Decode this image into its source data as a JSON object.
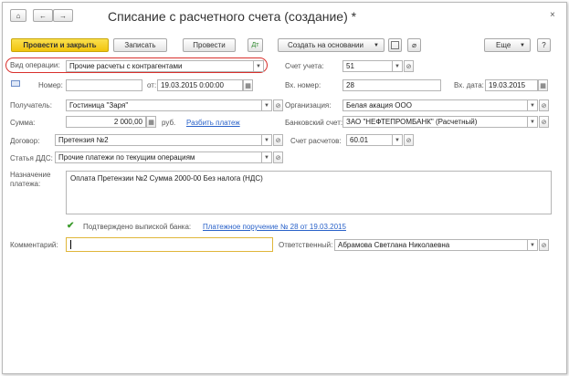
{
  "window": {
    "title": "Списание с расчетного счета (создание) *",
    "close_glyph": "×"
  },
  "nav": {
    "home_glyph": "⌂",
    "back_glyph": "←",
    "forward_glyph": "→"
  },
  "toolbar": {
    "post_close": "Провести и закрыть",
    "save": "Записать",
    "post": "Провести",
    "create_based": "Создать на основании",
    "more": "Еще",
    "help": "?"
  },
  "form": {
    "op_type": {
      "label": "Вид операции:",
      "value": "Прочие расчеты с контрагентами"
    },
    "account": {
      "label": "Счет учета:",
      "value": "51"
    },
    "number": {
      "label": "Номер:",
      "value": ""
    },
    "date": {
      "label": "от:",
      "value": "19.03.2015  0:00:00"
    },
    "in_number": {
      "label": "Вх. номер:",
      "value": "28"
    },
    "in_date": {
      "label": "Вх. дата:",
      "value": "19.03.2015"
    },
    "recipient": {
      "label": "Получатель:",
      "value": "Гостиница \"Заря\""
    },
    "organization": {
      "label": "Организация:",
      "value": "Белая акация ООО"
    },
    "amount": {
      "label": "Сумма:",
      "value": "2 000,00",
      "currency": "руб.",
      "split_link": "Разбить платеж"
    },
    "bank_account": {
      "label": "Банковский счет:",
      "value": "ЗАО \"НЕФТЕПРОМБАНК\" (Расчетный)"
    },
    "contract": {
      "label": "Договор:",
      "value": "Претензия №2"
    },
    "settlement_account": {
      "label": "Счет расчетов:",
      "value": "60.01"
    },
    "dds": {
      "label": "Статья ДДС:",
      "value": "Прочие платежи по текущим операциям"
    },
    "purpose": {
      "label_line1": "Назначение",
      "label_line2": "платежа:",
      "value": "Оплата Претензии №2 Сумма 2000-00 Без налога (НДС)"
    },
    "confirmed": {
      "label": "Подтверждено выпиской банка:",
      "link": "Платежное поручение № 28 от 19.03.2015",
      "checked": true
    },
    "comment": {
      "label": "Комментарий:",
      "value": ""
    },
    "responsible": {
      "label": "Ответственный:",
      "value": "Абрамова Светлана Николаевна"
    }
  },
  "colors": {
    "accent_yellow": "#f2c40d",
    "highlight_red": "#d9302c",
    "link_blue": "#2a62c9",
    "check_green": "#3a9a2a"
  }
}
